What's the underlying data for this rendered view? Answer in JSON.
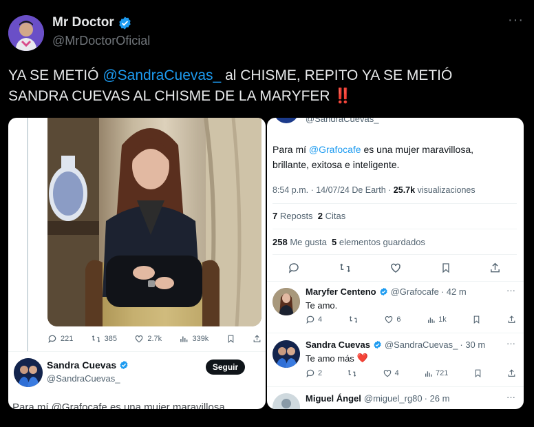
{
  "header": {
    "name": "Mr Doctor",
    "handle": "@MrDoctorOficial",
    "more": "···"
  },
  "tweet": {
    "line1_a": "YA SE METIÓ ",
    "line1_mention": "@SandraCuevas_",
    "line1_b": " al CHISME, REPITO YA SE METIÓ",
    "line2": "SANDRA CUEVAS AL CHISME DE LA MARYFER",
    "line2_emoji": "‼️"
  },
  "left_card": {
    "stats": {
      "replies": "221",
      "retweets": "385",
      "likes": "2.7k",
      "views": "339k"
    },
    "author": {
      "name": "Sandra Cuevas",
      "handle": "@SandraCuevas_",
      "follow": "Seguir"
    },
    "cut_text": "Para mí @Grafocafe es una mujer maravillosa"
  },
  "right_card": {
    "cut_handle": "@SandraCuevas_",
    "text_a": "Para mí ",
    "text_mention": "@Grafocafe",
    "text_b": " es una mujer maravillosa,",
    "text_line2": "brillante, exitosa e inteligente.",
    "meta_time": "8:54 p.m. · 14/07/24 De Earth · ",
    "meta_views_num": "25.7k",
    "meta_views_label": " visualizaciones",
    "reposts_num": "7",
    "reposts_label": "Reposts",
    "quotes_num": "2",
    "quotes_label": "Citas",
    "likes_num": "258",
    "likes_label": "Me gusta",
    "saved_num": "5",
    "saved_label": "elementos guardados",
    "replies": [
      {
        "name": "Maryfer Centeno",
        "handle": "@Grafocafe",
        "time": "· 42 m",
        "text": "Te amo.",
        "reply_count": "4",
        "like_count": "6",
        "views": "1k"
      },
      {
        "name": "Sandra Cuevas",
        "handle": "@SandraCuevas_",
        "time": "· 30 m",
        "text": "Te amo más",
        "emoji": "❤️",
        "reply_count": "2",
        "like_count": "4",
        "views": "721"
      },
      {
        "name": "Miguel Ángel",
        "handle": "@miguel_rg80",
        "time": "· 26 m"
      }
    ]
  },
  "colors": {
    "accent": "#1d9bf0",
    "verified": "#1d9bf0",
    "heart": "#e0245e",
    "background": "#000000"
  }
}
